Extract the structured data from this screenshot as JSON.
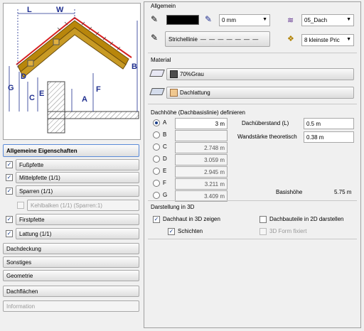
{
  "diagram": {
    "labels": [
      "L",
      "W",
      "B",
      "G",
      "D",
      "C",
      "E",
      "A",
      "F"
    ]
  },
  "left_panel": {
    "header": "Allgemeine Eigenschaften",
    "items": [
      {
        "label": "Fußpfette",
        "checked": true
      },
      {
        "label": "Mittelpfette (1/1)",
        "checked": true
      },
      {
        "label": "Sparren (1/1)",
        "checked": true
      },
      {
        "label": "Kehlbalken (1/1) (Sparren:1)",
        "checked": false,
        "disabled": true
      },
      {
        "label": "Firstpfette",
        "checked": true
      },
      {
        "label": "Lattung (1/1)",
        "checked": true
      }
    ],
    "sections": [
      "Dachdeckung",
      "Sonstiges",
      "Geometrie",
      "Dachflächen",
      "Information"
    ]
  },
  "allgemein": {
    "title": "Allgemein",
    "pen_thickness": "0 mm",
    "layer": "05_Dach",
    "linetype": "Strichellinie",
    "priority": "8 kleinste Pric"
  },
  "material": {
    "title": "Material",
    "material1": "70%Grau",
    "material2": "Dachlattung"
  },
  "dachhoehe": {
    "title": "Dachhöhe (Dachbasislinie) definieren",
    "options": [
      {
        "letter": "A",
        "value": "3 m",
        "selected": true
      },
      {
        "letter": "B",
        "value": ""
      },
      {
        "letter": "C",
        "value": "2.748 m"
      },
      {
        "letter": "D",
        "value": "3.059 m"
      },
      {
        "letter": "E",
        "value": "2.945 m"
      },
      {
        "letter": "F",
        "value": "3.211 m"
      },
      {
        "letter": "G",
        "value": "3.409 m"
      }
    ],
    "ueberstand_label": "Dachüberstand (L)",
    "ueberstand_value": "0.5 m",
    "wandstaerke_label": "Wandstärke theoretisch",
    "wandstaerke_value": "0.38 m",
    "basishoehe_label": "Basishöhe",
    "basishoehe_value": "5.75 m"
  },
  "darstellung": {
    "title": "Darstellung in 3D",
    "dachhaut_label": "Dachhaut in 3D zeigen",
    "dachhaut_checked": true,
    "schichten_label": "Schichten",
    "schichten_checked": true,
    "bauteile_label": "Dachbauteile in 2D darstellen",
    "bauteile_checked": false,
    "form_label": "3D Form fixiert",
    "form_checked": false
  },
  "colors": {
    "roof_fill": "#b8860b",
    "roof_outline": "#d62020",
    "dimension": "#1f2f8f",
    "selected_tab_border": "#5b8bd8"
  }
}
